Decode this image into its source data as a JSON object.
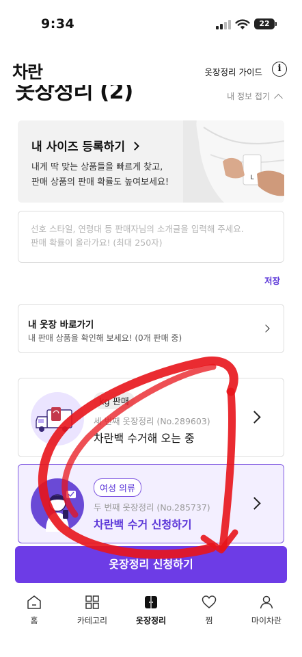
{
  "status_bar": {
    "time": "9:34",
    "battery": "22"
  },
  "header": {
    "logo": "차란",
    "guide_label": "옷장정리 가이드"
  },
  "section": {
    "title": "옷장정리 (2)",
    "collapse_label": "내 정보 접기"
  },
  "size_card": {
    "title": "내 사이즈 등록하기",
    "desc_line1": "내게 딱 맞는 상품들을 빠르게 찾고,",
    "desc_line2": "판매 상품의 판매 확률도 높여보세요!",
    "image_tag_text": "L"
  },
  "intro": {
    "placeholder_line1": "선호 스타일, 연령대 등 판매자님의 소개글을 입력해 주세요.",
    "placeholder_line2": "판매 확률이 올라가요! (최대 250자)",
    "save_label": "저장"
  },
  "closet_link": {
    "title": "내 옷장 바로가기",
    "subtitle": "내 판매 상품을 확인해 보세요! (0개 판매 중)"
  },
  "orders": [
    {
      "tag": "kg 판매",
      "number": "세 번째 옷장정리 (No.289603)",
      "status": "차란백 수거해 오는 중",
      "illustration_icon": "delivery-truck-icon"
    },
    {
      "tag": "여성 의류",
      "number": "두 번째 옷장정리 (No.285737)",
      "status": "차란백 수거 신청하기",
      "illustration_icon": "woman-phone-icon"
    }
  ],
  "cta": {
    "label": "옷장정리 신청하기"
  },
  "tabs": [
    {
      "label": "홈",
      "icon": "home-icon",
      "active": false
    },
    {
      "label": "카테고리",
      "icon": "category-grid-icon",
      "active": false
    },
    {
      "label": "옷장정리",
      "icon": "closet-icon",
      "active": true
    },
    {
      "label": "찜",
      "icon": "heart-icon",
      "active": false
    },
    {
      "label": "마이차란",
      "icon": "person-icon",
      "active": false
    }
  ],
  "colors": {
    "accent": "#6d3ce6",
    "accent_text": "#5a35d8",
    "card_highlight_bg": "#f3efff",
    "scribble": "#e8141b"
  }
}
